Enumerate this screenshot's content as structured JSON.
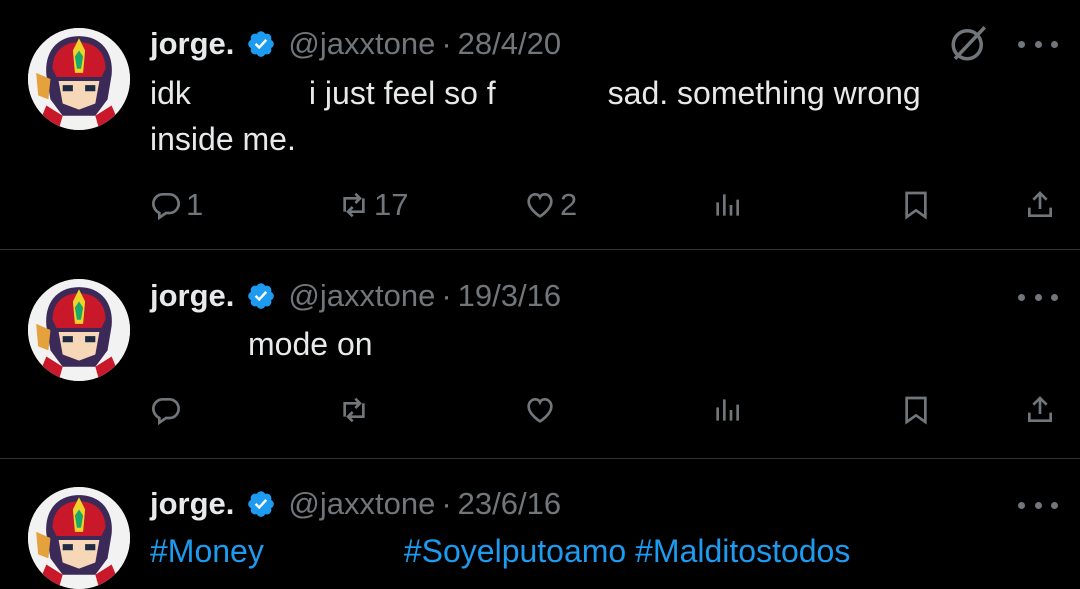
{
  "tweets": [
    {
      "name": "jorge.",
      "handle": "@jaxxtone",
      "separator": "·",
      "date": "28/4/20",
      "text_line1_a": "idk",
      "text_line1_b": "i just feel so f",
      "text_line1_c": "sad. something wrong",
      "text_line2": "inside me.",
      "replies": "1",
      "reposts": "17",
      "likes": "2",
      "has_grok": true
    },
    {
      "name": "jorge.",
      "handle": "@jaxxtone",
      "separator": "·",
      "date": "19/3/16",
      "text_line1": "mode on",
      "replies": "",
      "reposts": "",
      "likes": ""
    },
    {
      "name": "jorge.",
      "handle": "@jaxxtone",
      "separator": "·",
      "date": "23/6/16",
      "hashtag1": "#Money",
      "hashtag2": "#Soyelputoamo",
      "hashtag3": "#Malditostodos"
    }
  ],
  "icons": {
    "verified": "verified-badge-icon",
    "reply": "reply-icon",
    "repost": "repost-icon",
    "like": "heart-icon",
    "views": "views-icon",
    "bookmark": "bookmark-icon",
    "share": "share-icon",
    "more": "more-icon",
    "grok": "grok-icon"
  },
  "colors": {
    "background": "#000000",
    "text": "#e7e9ea",
    "muted": "#71767b",
    "accent": "#1d9bf0",
    "divider": "#2f3336"
  }
}
